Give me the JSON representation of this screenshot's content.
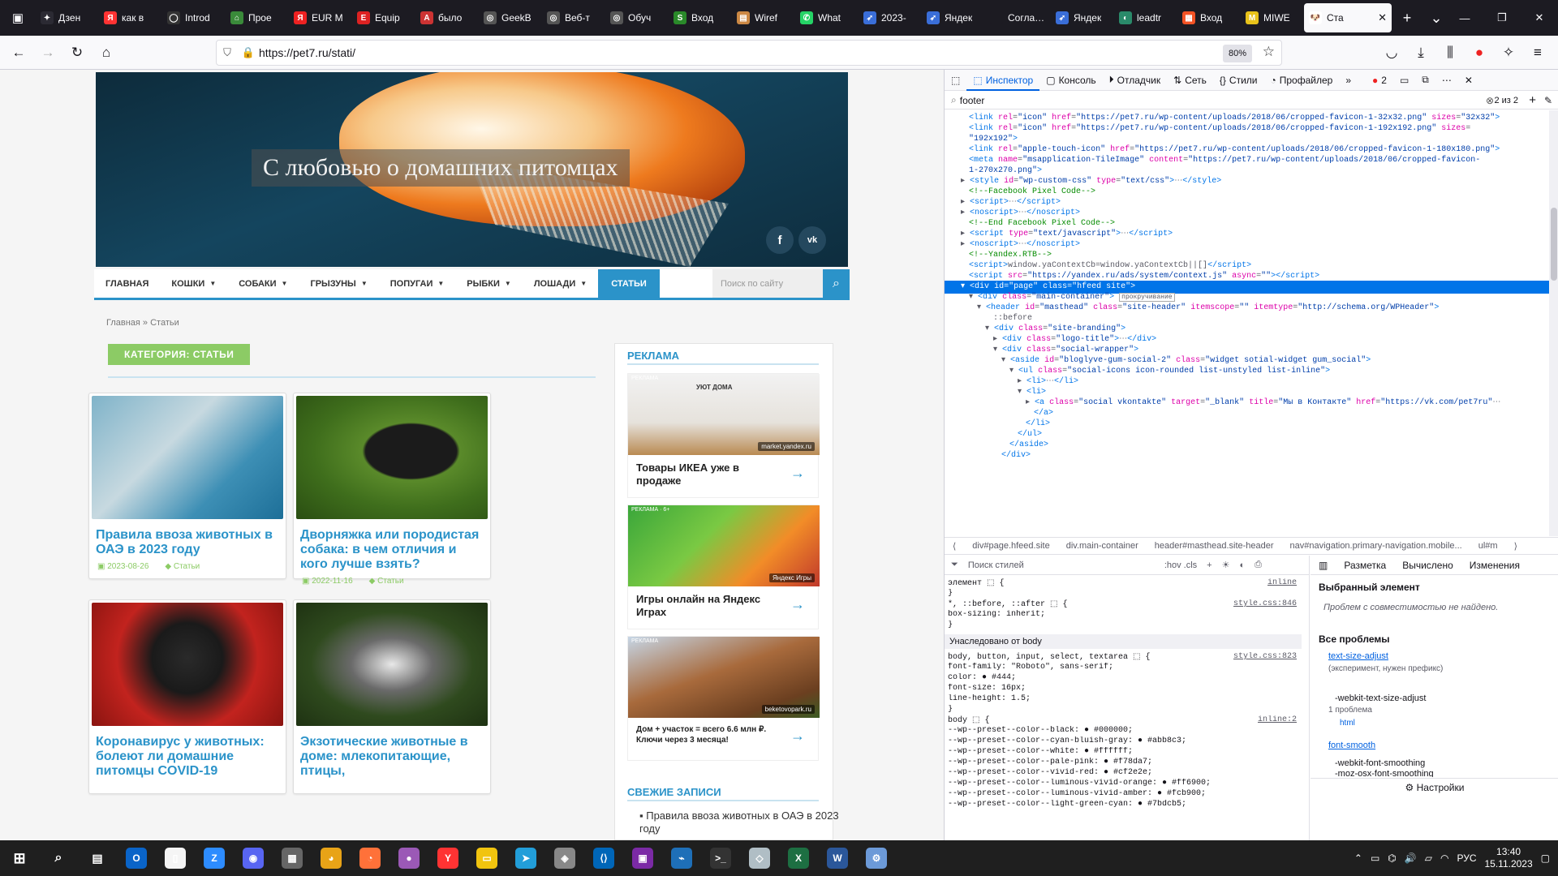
{
  "browser": {
    "tabs": [
      {
        "label": "Дзен",
        "color": "#2b2a33",
        "glyph": "✦"
      },
      {
        "label": "как в",
        "color": "#f33",
        "glyph": "Я"
      },
      {
        "label": "Introd",
        "color": "#333",
        "glyph": "◯"
      },
      {
        "label": "Прое",
        "color": "#3a8a3a",
        "glyph": "⌂"
      },
      {
        "label": "EUR M",
        "color": "#e22",
        "glyph": "Я"
      },
      {
        "label": "Equip",
        "color": "#d22",
        "glyph": "E"
      },
      {
        "label": "было",
        "color": "#c33",
        "glyph": "А"
      },
      {
        "label": "GeekB",
        "color": "#555",
        "glyph": "◎"
      },
      {
        "label": "Веб-т",
        "color": "#555",
        "glyph": "◎"
      },
      {
        "label": "Обуч",
        "color": "#555",
        "glyph": "◎"
      },
      {
        "label": "Вход",
        "color": "#2a8a2a",
        "glyph": "S"
      },
      {
        "label": "Wiref",
        "color": "#c84",
        "glyph": "▤"
      },
      {
        "label": "What",
        "color": "#25d366",
        "glyph": "✆"
      },
      {
        "label": "2023-",
        "color": "#3a6ed8",
        "glyph": "➶"
      },
      {
        "label": "Яндек",
        "color": "#3a6ed8",
        "glyph": "➶"
      },
      {
        "label": "Согласие",
        "color": "#1c1b22",
        "glyph": ""
      },
      {
        "label": "Яндек",
        "color": "#3a6ed8",
        "glyph": "➶"
      },
      {
        "label": "leadtr",
        "color": "#2a8a6a",
        "glyph": "◐"
      },
      {
        "label": "Вход",
        "color": "#f35325",
        "glyph": "▦"
      },
      {
        "label": "MIWE",
        "color": "#e8c21a",
        "glyph": "M"
      }
    ],
    "active_tab": {
      "label": "Ста",
      "glyph": "🐶"
    },
    "url": "https://pet7.ru/stati/",
    "zoom": "80%"
  },
  "site": {
    "hero_title": "С любовью о домашних питомцах",
    "social": [
      "f",
      "vk"
    ],
    "menu": [
      {
        "label": "ГЛАВНАЯ",
        "caret": false
      },
      {
        "label": "КОШКИ",
        "caret": true
      },
      {
        "label": "СОБАКИ",
        "caret": true
      },
      {
        "label": "ГРЫЗУНЫ",
        "caret": true
      },
      {
        "label": "ПОПУГАИ",
        "caret": true
      },
      {
        "label": "РЫБКИ",
        "caret": true
      },
      {
        "label": "ЛОШАДИ",
        "caret": true
      }
    ],
    "menu_active": "СТАТЬИ",
    "search_placeholder": "Поиск по сайту",
    "breadcrumb": "Главная » Статьи",
    "category": "КАТЕГОРИЯ: СТАТЬИ",
    "cards": [
      {
        "title": "Правила ввоза животных в ОАЭ в 2023 году",
        "date": "2023-08-26",
        "cat": "Статьи",
        "img": "linear-gradient(135deg,#7fb3c9 0%,#c7d9e0 40%,#3d8fb5 70%,#1d6f98 100%)"
      },
      {
        "title": "Дворняжка или породистая собака: в чем отличия и кого лучше взять?",
        "date": "2022-11-16",
        "cat": "Статьи",
        "img": "radial-gradient(ellipse at 60% 45%,#1b1b1b 0%,#1b1b1b 28%,#5a8a2a 30%,#3f6e1c 60%,#2a4e12 100%)"
      },
      {
        "title": "Коронавирус у животных: болеют ли домашние питомцы COVID-19",
        "date": "",
        "cat": "",
        "img": "radial-gradient(circle at 50% 45%,#2a2a2a 0%,#1a1a1a 30%,#c2231e 60%,#8a1410 100%)"
      },
      {
        "title": "Экзотические животные в доме: млекопитающие, птицы,",
        "date": "",
        "cat": "",
        "img": "radial-gradient(ellipse at 50% 50%,#e8e8e8 0%,#6a6a6a 30%,#2f4a1e 60%,#1e3212 100%)"
      }
    ],
    "sidebar": {
      "ads_title": "РЕКЛАМА",
      "ads": [
        {
          "tag": "РЕКЛАМА",
          "text": "Товары ИКЕА уже в продаже",
          "img": "linear-gradient(180deg,#f2f2f2 0%,#e6e2dc 60%,#b98a52 100%)",
          "badge": "market.yandex.ru",
          "sub": "УЮТ ДОМА"
        },
        {
          "tag": "РЕКЛАМА · 6+",
          "text": "Игры онлайн на Яндекс Играх",
          "img": "linear-gradient(135deg,#3aa63a 0%,#7ac943 40%,#f28c28 70%,#c0392b 100%)",
          "badge": "Яндекс Игры",
          "sub": ""
        },
        {
          "tag": "РЕКЛАМА",
          "text": "Дом + участок = всего 6.6 млн ₽. Ключи через 3 месяца!",
          "img": "linear-gradient(160deg,#c6d6e6 0%,#a86a3c 45%,#6b3f20 80%,#3a5a22 100%)",
          "badge": "beketovopark.ru",
          "sub": ""
        }
      ],
      "recent_title": "СВЕЖИЕ ЗАПИСИ",
      "recent": [
        "Правила ввоза животных в ОАЭ в 2023 году"
      ]
    }
  },
  "devtools": {
    "tabs": [
      "Инспектор",
      "Консоль",
      "Отладчик",
      "Сеть",
      "Стили",
      "Профайлер"
    ],
    "errors": "2",
    "search": "footer",
    "search_count": "2 из 2",
    "breadcrumbs": [
      "div#page.hfeed.site",
      "div.main-container",
      "header#masthead.site-header",
      "nav#navigation.primary-navigation.mobile...",
      "ul#m"
    ],
    "tree": [
      {
        "i": 3,
        "html": "<span class='tg'>&lt;link</span> <span class='at'>rel</span>=<span class='av'>\"icon\"</span> <span class='at'>href</span>=<span class='av'>\"https://pet7.ru/wp-content/uploads/2018/06/cropped-favicon-1-32x32.png\"</span> <span class='at'>sizes</span>=<span class='av'>\"32x32\"</span><span class='tg'>&gt;</span>"
      },
      {
        "i": 3,
        "html": "<span class='tg'>&lt;link</span> <span class='at'>rel</span>=<span class='av'>\"icon\"</span> <span class='at'>href</span>=<span class='av'>\"https://pet7.ru/wp-content/uploads/2018/06/cropped-favicon-1-192x192.png\"</span> <span class='at'>sizes</span>="
      },
      {
        "i": 3,
        "html": "<span class='av'>\"192x192\"</span><span class='tg'>&gt;</span>"
      },
      {
        "i": 3,
        "html": "<span class='tg'>&lt;link</span> <span class='at'>rel</span>=<span class='av'>\"apple-touch-icon\"</span> <span class='at'>href</span>=<span class='av'>\"https://pet7.ru/wp-content/uploads/2018/06/cropped-favicon-1-180x180.png\"</span><span class='tg'>&gt;</span>"
      },
      {
        "i": 3,
        "html": "<span class='tg'>&lt;meta</span> <span class='at'>name</span>=<span class='av'>\"msapplication-TileImage\"</span> <span class='at'>content</span>=<span class='av'>\"https://pet7.ru/wp-content/uploads/2018/06/cropped-favicon-</span>"
      },
      {
        "i": 3,
        "html": "<span class='av'>1-270x270.png\"</span><span class='tg'>&gt;</span>"
      },
      {
        "i": 2,
        "html": "▸ <span class='tg'>&lt;style</span> <span class='at'>id</span>=<span class='av'>\"wp-custom-css\"</span> <span class='at'>type</span>=<span class='av'>\"text/css\"</span><span class='tg'>&gt;</span>⋯<span class='tg'>&lt;/style&gt;</span>"
      },
      {
        "i": 3,
        "html": "<span class='cm'>&lt;!--Facebook Pixel Code--&gt;</span>"
      },
      {
        "i": 2,
        "html": "▸ <span class='tg'>&lt;script&gt;</span>⋯<span class='tg'>&lt;/script&gt;</span>"
      },
      {
        "i": 2,
        "html": "▸ <span class='tg'>&lt;noscript&gt;</span>⋯<span class='tg'>&lt;/noscript&gt;</span>"
      },
      {
        "i": 3,
        "html": "<span class='cm'>&lt;!--End Facebook Pixel Code--&gt;</span>"
      },
      {
        "i": 2,
        "html": "▸ <span class='tg'>&lt;script</span> <span class='at'>type</span>=<span class='av'>\"text/javascript\"</span><span class='tg'>&gt;</span>⋯<span class='tg'>&lt;/script&gt;</span>"
      },
      {
        "i": 2,
        "html": "▸ <span class='tg'>&lt;noscript&gt;</span>⋯<span class='tg'>&lt;/noscript&gt;</span>"
      },
      {
        "i": 3,
        "html": "<span class='cm'>&lt;!--Yandex.RTB--&gt;</span>"
      },
      {
        "i": 3,
        "html": "<span class='tg'>&lt;script&gt;</span>window.yaContextCb=window.yaContextCb||[]<span class='tg'>&lt;/script&gt;</span>"
      },
      {
        "i": 3,
        "html": "<span class='tg'>&lt;script</span> <span class='at'>src</span>=<span class='av'>\"https://yandex.ru/ads/system/context.js\"</span> <span class='at'>async</span>=<span class='av'>\"\"</span><span class='tg'>&gt;&lt;/script&gt;</span>"
      },
      {
        "i": 2,
        "sel": true,
        "html": "▾ <span class='tg'>&lt;div</span> <span class='at'>id</span>=<span class='av'>\"page\"</span> <span class='at'>class</span>=<span class='av'>\"hfeed site\"</span><span class='tg'>&gt;</span>"
      },
      {
        "i": 3,
        "html": "▾ <span class='tg'>&lt;div</span> <span class='at'>class</span>=<span class='av'>\"main-container\"</span><span class='tg'>&gt;</span> <span style='border:1px solid #aaa;font-size:8px;padding:0 2px'>прокручивание</span>"
      },
      {
        "i": 4,
        "html": "▾ <span class='tg'>&lt;header</span> <span class='at'>id</span>=<span class='av'>\"masthead\"</span> <span class='at'>class</span>=<span class='av'>\"site-header\"</span> <span class='at'>itemscope</span>=<span class='av'>\"\"</span> <span class='at'>itemtype</span>=<span class='av'>\"http://schema.org/WPHeader\"</span><span class='tg'>&gt;</span>"
      },
      {
        "i": 6,
        "html": "::before"
      },
      {
        "i": 5,
        "html": "▾ <span class='tg'>&lt;div</span> <span class='at'>class</span>=<span class='av'>\"site-branding\"</span><span class='tg'>&gt;</span>"
      },
      {
        "i": 6,
        "html": "▸ <span class='tg'>&lt;div</span> <span class='at'>class</span>=<span class='av'>\"logo-title\"</span><span class='tg'>&gt;</span>⋯<span class='tg'>&lt;/div&gt;</span>"
      },
      {
        "i": 6,
        "html": "▾ <span class='tg'>&lt;div</span> <span class='at'>class</span>=<span class='av'>\"social-wrapper\"</span><span class='tg'>&gt;</span>"
      },
      {
        "i": 7,
        "html": "▾ <span class='tg'>&lt;aside</span> <span class='at'>id</span>=<span class='av'>\"bloglyve-gum-social-2\"</span> <span class='at'>class</span>=<span class='av'>\"widget sotial-widget gum_social\"</span><span class='tg'>&gt;</span>"
      },
      {
        "i": 8,
        "html": "▾ <span class='tg'>&lt;ul</span> <span class='at'>class</span>=<span class='av'>\"social-icons icon-rounded list-unstyled list-inline\"</span><span class='tg'>&gt;</span>"
      },
      {
        "i": 9,
        "html": "▸ <span class='tg'>&lt;li&gt;</span>⋯<span class='tg'>&lt;/li&gt;</span>"
      },
      {
        "i": 9,
        "html": "▾ <span class='tg'>&lt;li&gt;</span>"
      },
      {
        "i": 10,
        "html": "▸ <span class='tg'>&lt;a</span> <span class='at'>class</span>=<span class='av'>\"social vkontakte\"</span> <span class='at'>target</span>=<span class='av'>\"_blank\"</span> <span class='at'>title</span>=<span class='av'>\"Мы в Контакте\"</span> <span class='at'>href</span>=<span class='av'>\"https://vk.com/pet7ru\"</span>⋯"
      },
      {
        "i": 11,
        "html": "<span class='tg'>&lt;/a&gt;</span>"
      },
      {
        "i": 10,
        "html": "<span class='tg'>&lt;/li&gt;</span>"
      },
      {
        "i": 9,
        "html": "<span class='tg'>&lt;/ul&gt;</span>"
      },
      {
        "i": 8,
        "html": "<span class='tg'>&lt;/aside&gt;</span>"
      },
      {
        "i": 7,
        "html": "<span class='tg'>&lt;/div&gt;</span>"
      }
    ],
    "styles_search": "Поиск стилей",
    "styles_tools": ":hov   .cls",
    "rules": [
      {
        "t": "элемент ⬚ {",
        "src": "inline"
      },
      {
        "t": "}",
        "src": ""
      },
      {
        "t": "*, ::before, ::after ⬚ {",
        "src": "style.css:846"
      },
      {
        "t": "  box-sizing: inherit;",
        "src": ""
      },
      {
        "t": "}",
        "src": ""
      }
    ],
    "inherited": "Унаследовано от body",
    "rules2": [
      {
        "t": "body, button, input, select, textarea ⬚ {",
        "src": "style.css:823"
      },
      {
        "t": "  font-family: \"Roboto\", sans-serif;",
        "src": ""
      },
      {
        "t": "  color: ● #444;",
        "src": ""
      },
      {
        "t": "  font-size: 16px;",
        "src": ""
      },
      {
        "t": "  line-height: 1.5;",
        "src": ""
      },
      {
        "t": "}",
        "src": ""
      },
      {
        "t": "body ⬚ {",
        "src": "inline:2"
      },
      {
        "t": "  --wp--preset--color--black: ● #000000;",
        "src": ""
      },
      {
        "t": "  --wp--preset--color--cyan-bluish-gray: ● #abb8c3;",
        "src": ""
      },
      {
        "t": "  --wp--preset--color--white: ● #ffffff;",
        "src": ""
      },
      {
        "t": "  --wp--preset--color--pale-pink: ● #f78da7;",
        "src": ""
      },
      {
        "t": "  --wp--preset--color--vivid-red: ● #cf2e2e;",
        "src": ""
      },
      {
        "t": "  --wp--preset--color--luminous-vivid-orange: ● #ff6900;",
        "src": ""
      },
      {
        "t": "  --wp--preset--color--luminous-vivid-amber: ● #fcb900;",
        "src": ""
      },
      {
        "t": "  --wp--preset--color--light-green-cyan: ● #7bdcb5;",
        "src": ""
      }
    ],
    "compat_tabs": [
      "Разметка",
      "Вычислено",
      "Изменения"
    ],
    "compat_selected": "Выбранный элемент",
    "compat_none": "Проблем с совместимостью не найдено.",
    "compat_all": "Все проблемы",
    "issue1": "text-size-adjust",
    "issue1_note": "(эксперимент, нужен префикс)",
    "issue1_prefix": "-webkit-text-size-adjust",
    "issue1_count": "1 проблема",
    "issue1_el": "html",
    "issue2": "font-smooth",
    "issue2_a": "-webkit-font-smoothing",
    "issue2_b": "-moz-osx-font-smoothing",
    "settings": "Настройки"
  },
  "taskbar": {
    "apps": [
      {
        "g": "O",
        "c": "#0a64c8"
      },
      {
        "g": "▯",
        "c": "#f5f5f5"
      },
      {
        "g": "Z",
        "c": "#2d8cff"
      },
      {
        "g": "◉",
        "c": "#5865f2"
      },
      {
        "g": "▦",
        "c": "#666"
      },
      {
        "g": "◕",
        "c": "#e8a317"
      },
      {
        "g": "◔",
        "c": "#ff7139"
      },
      {
        "g": "●",
        "c": "#9b59b6"
      },
      {
        "g": "Y",
        "c": "#f33"
      },
      {
        "g": "▭",
        "c": "#f1c40f"
      },
      {
        "g": "➤",
        "c": "#229ed9"
      },
      {
        "g": "◈",
        "c": "#888"
      },
      {
        "g": "⟨⟩",
        "c": "#0066b8"
      },
      {
        "g": "▣",
        "c": "#7b2aa5"
      },
      {
        "g": "⌁",
        "c": "#1e6fb8"
      },
      {
        "g": ">_",
        "c": "#333"
      },
      {
        "g": "◇",
        "c": "#b0bec5"
      },
      {
        "g": "X",
        "c": "#1d6f42"
      },
      {
        "g": "W",
        "c": "#2b579a"
      },
      {
        "g": "⚙",
        "c": "#6c9ad8"
      }
    ],
    "lang": "РУС",
    "time": "13:40",
    "date": "15.11.2023"
  }
}
